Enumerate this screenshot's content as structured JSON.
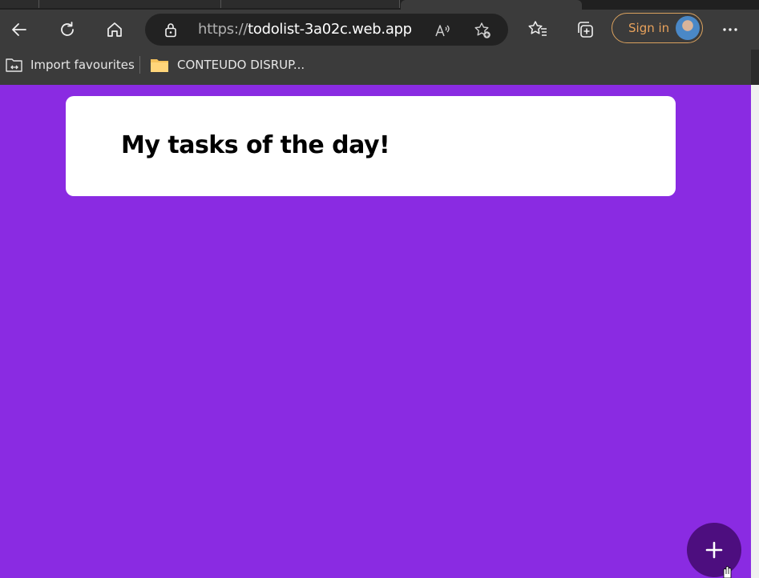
{
  "browser": {
    "url_protocol": "https://",
    "url_host": "todolist-3a02c.web.app",
    "sign_in_label": "Sign in",
    "bookmarks": [
      {
        "label": "Import favourites",
        "icon": "import-favourites-icon"
      },
      {
        "label": "CONTEUDO DISRUP...",
        "icon": "folder-icon"
      }
    ]
  },
  "page": {
    "title": "My tasks of the day!",
    "add_button_symbol": "+"
  },
  "colors": {
    "background": "#8a2be2",
    "card": "#ffffff",
    "fab": "#4d0e7f",
    "chrome": "#3b3b3b",
    "signin_accent": "#e8a25c"
  }
}
